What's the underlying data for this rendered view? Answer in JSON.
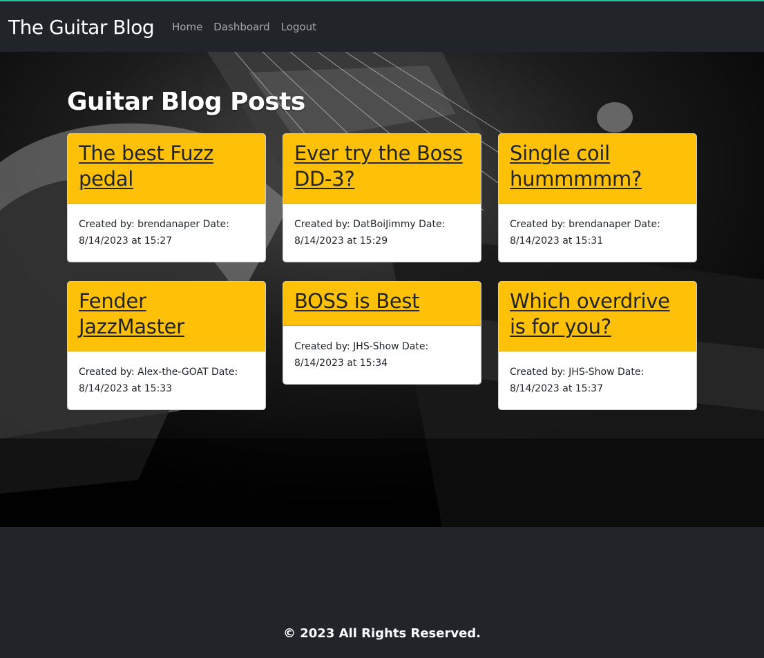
{
  "nav": {
    "brand": "The Guitar Blog",
    "links": [
      "Home",
      "Dashboard",
      "Logout"
    ]
  },
  "main": {
    "title": "Guitar Blog Posts",
    "posts": [
      {
        "title": "The best Fuzz pedal",
        "meta": "Created by: brendanaper Date: 8/14/2023 at 15:27"
      },
      {
        "title": "Ever try the Boss DD-3?",
        "meta": "Created by: DatBoiJimmy Date: 8/14/2023 at 15:29"
      },
      {
        "title": "Single coil hummmmm?",
        "meta": "Created by: brendanaper Date: 8/14/2023 at 15:31"
      },
      {
        "title": "Fender JazzMaster",
        "meta": "Created by: Alex-the-GOAT Date: 8/14/2023 at 15:33"
      },
      {
        "title": "BOSS is Best",
        "meta": "Created by: JHS-Show Date: 8/14/2023 at 15:34"
      },
      {
        "title": "Which overdrive is for you?",
        "meta": "Created by: JHS-Show Date: 8/14/2023 at 15:37"
      }
    ]
  },
  "footer": {
    "text": "© 2023 All Rights Reserved."
  },
  "colors": {
    "navbar_bg": "#212529",
    "card_header": "#ffc107",
    "accent_line": "#20c997",
    "hero_bg": "#050505"
  }
}
